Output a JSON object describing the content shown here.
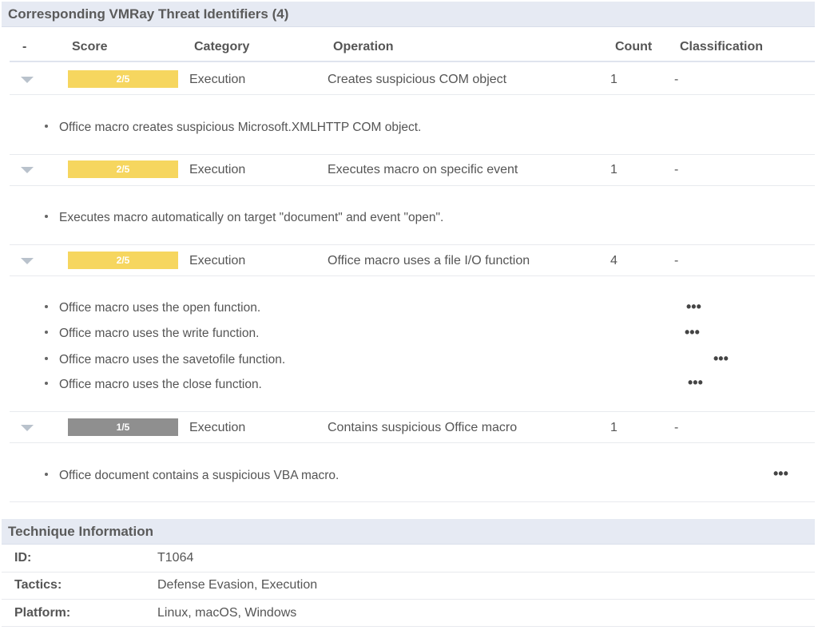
{
  "threat_section": {
    "title": "Corresponding VMRay Threat Identifiers (4)"
  },
  "columns": {
    "toggle": "-",
    "score": "Score",
    "category": "Category",
    "operation": "Operation",
    "count": "Count",
    "classification": "Classification"
  },
  "rows": [
    {
      "score": "2/5",
      "score_color": "#f6d65f",
      "category": "Execution",
      "operation": "Creates suspicious COM object",
      "count": "1",
      "classification": "-",
      "details": [
        "Office macro creates suspicious Microsoft.XMLHTTP COM object."
      ]
    },
    {
      "score": "2/5",
      "score_color": "#f6d65f",
      "category": "Execution",
      "operation": "Executes macro on specific event",
      "count": "1",
      "classification": "-",
      "details": [
        "Executes macro automatically on target \"document\" and event \"open\"."
      ]
    },
    {
      "score": "2/5",
      "score_color": "#f6d65f",
      "category": "Execution",
      "operation": "Office macro uses a file I/O function",
      "count": "4",
      "classification": "-",
      "details": [
        "Office macro uses the open function.",
        "Office macro uses the write function.",
        "Office macro uses the savetofile function.",
        "Office macro uses the close function."
      ]
    },
    {
      "score": "1/5",
      "score_color": "#8f8f8f",
      "category": "Execution",
      "operation": "Contains suspicious Office macro",
      "count": "1",
      "classification": "-",
      "details": [
        "Office document contains a suspicious VBA macro."
      ]
    }
  ],
  "more_glyph": "•••",
  "technique_section": {
    "title": "Technique Information",
    "fields": [
      {
        "label": "ID:",
        "value": "T1064"
      },
      {
        "label": "Tactics:",
        "value": "Defense Evasion, Execution"
      },
      {
        "label": "Platform:",
        "value": "Linux, macOS, Windows"
      }
    ]
  }
}
